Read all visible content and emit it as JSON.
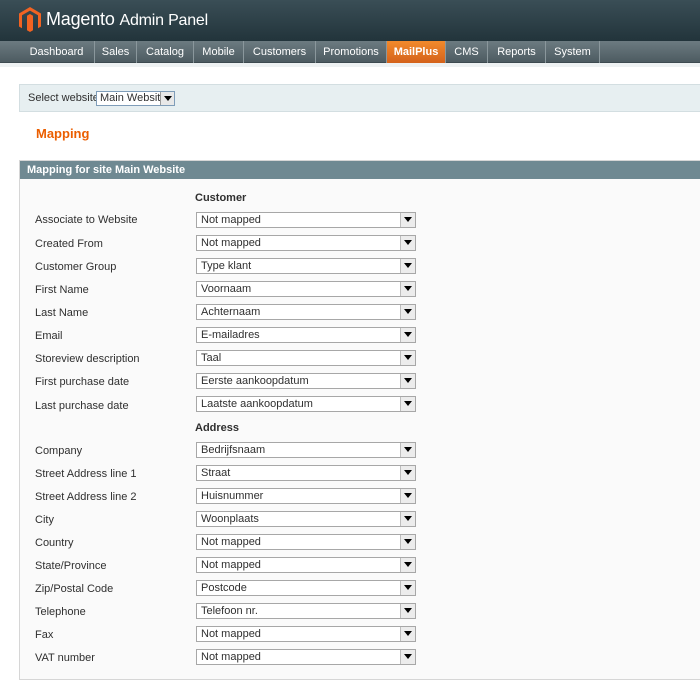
{
  "header": {
    "brand": "Magento",
    "subtitle": "Admin Panel"
  },
  "nav": {
    "items": [
      {
        "label": "Dashboard"
      },
      {
        "label": "Sales"
      },
      {
        "label": "Catalog"
      },
      {
        "label": "Mobile"
      },
      {
        "label": "Customers"
      },
      {
        "label": "Promotions"
      },
      {
        "label": "MailPlus",
        "active": true
      },
      {
        "label": "CMS"
      },
      {
        "label": "Reports"
      },
      {
        "label": "System"
      }
    ]
  },
  "website_switcher": {
    "label": "Select website:",
    "value": "Main Website"
  },
  "page_title": "Mapping",
  "section": {
    "title": "Mapping for site Main Website",
    "groups": [
      {
        "title": "Customer",
        "rows": [
          {
            "label": "Associate to Website",
            "value": "Not mapped"
          },
          {
            "label": "Created From",
            "value": "Not mapped"
          },
          {
            "label": "Customer Group",
            "value": "Type klant"
          },
          {
            "label": "First Name",
            "value": "Voornaam"
          },
          {
            "label": "Last Name",
            "value": "Achternaam"
          },
          {
            "label": "Email",
            "value": "E-mailadres"
          },
          {
            "label": "Storeview description",
            "value": "Taal"
          },
          {
            "label": "First purchase date",
            "value": "Eerste aankoopdatum"
          },
          {
            "label": "Last purchase date",
            "value": "Laatste aankoopdatum"
          }
        ]
      },
      {
        "title": "Address",
        "rows": [
          {
            "label": "Company",
            "value": "Bedrijfsnaam"
          },
          {
            "label": "Street Address line 1",
            "value": "Straat"
          },
          {
            "label": "Street Address line 2",
            "value": "Huisnummer"
          },
          {
            "label": "City",
            "value": "Woonplaats"
          },
          {
            "label": "Country",
            "value": "Not mapped"
          },
          {
            "label": "State/Province",
            "value": "Not mapped"
          },
          {
            "label": "Zip/Postal Code",
            "value": "Postcode"
          },
          {
            "label": "Telephone",
            "value": "Telefoon nr."
          },
          {
            "label": "Fax",
            "value": "Not mapped"
          },
          {
            "label": "VAT number",
            "value": "Not mapped"
          }
        ]
      }
    ]
  },
  "colors": {
    "header_bg": "#2a3d45",
    "nav_bg": "#5d6b71",
    "nav_active": "#e0731f",
    "title_orange": "#eb5e00",
    "section_head": "#6f8992"
  }
}
